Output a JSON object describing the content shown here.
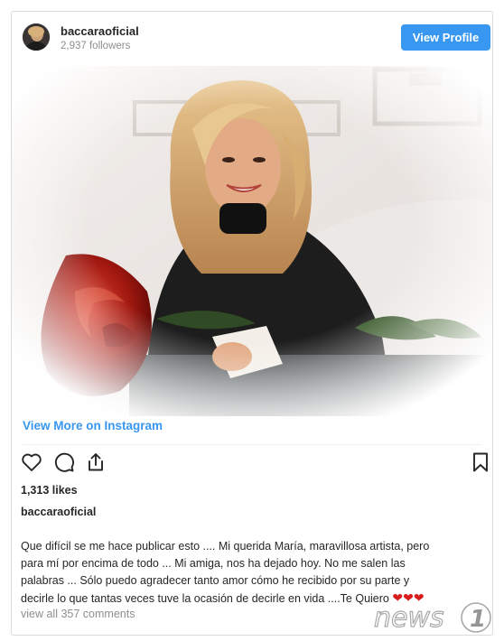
{
  "post": {
    "username": "baccaraoficial",
    "followers": "2,937 followers",
    "view_profile_label": "View Profile",
    "view_more_label": "View More on Instagram",
    "likes": "1,313 likes",
    "caption_user": "baccaraoficial",
    "caption_lines": [
      "Que difícil se me hace publicar esto .... Mi querida María, maravillosa artista, pero",
      "para mí por encima de todo ... Mi amiga, nos ha dejado hoy. No me salen las",
      "palabras ... Sólo puedo agradecer tanto amor cómo he recibido por su parte y",
      "decirle lo que tantas veces tuve la ocasión de decirle en vida ....Te Quiero"
    ],
    "caption_hearts": "❤❤❤",
    "comments_label": "view all 357 comments"
  },
  "icons": {
    "like": "heart-icon",
    "comment": "comment-icon",
    "share": "share-icon",
    "save": "bookmark-icon"
  },
  "watermark": {
    "text": "news",
    "number": "1"
  },
  "colors": {
    "accent": "#3897f0",
    "text": "#262626",
    "muted": "#8e8e8e",
    "heart": "#d81d1d"
  }
}
